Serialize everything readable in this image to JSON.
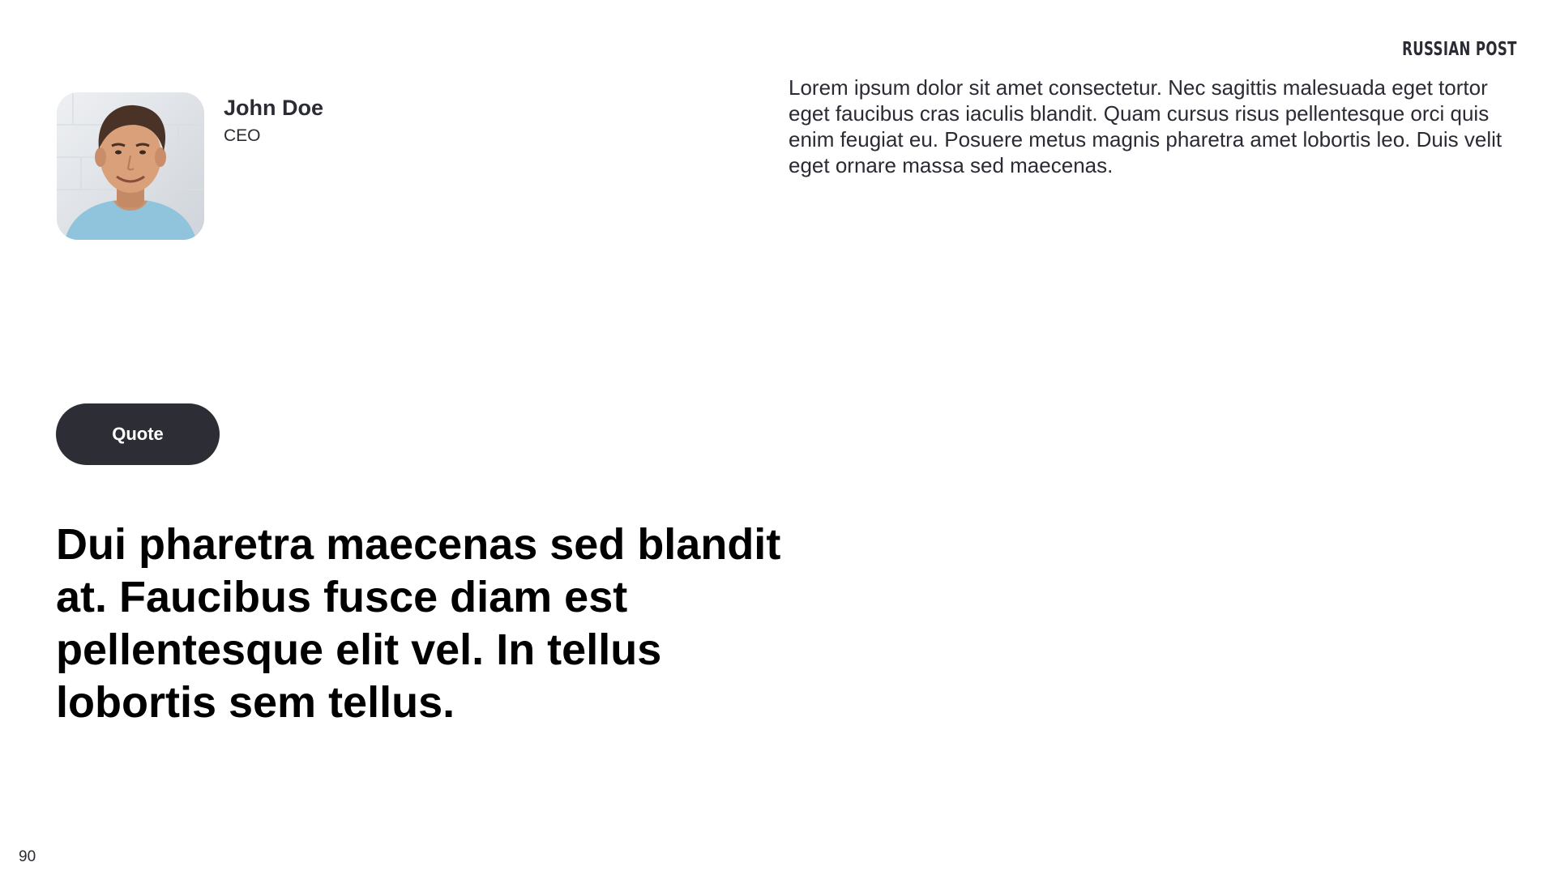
{
  "brand": {
    "logo_text": "RUSSIAN POST"
  },
  "profile": {
    "name": "John Doe",
    "role": "CEO"
  },
  "intro": {
    "text": "Lorem ipsum dolor sit amet consectetur. Nec sagittis malesuada eget tortor eget faucibus cras iaculis blandit. Quam cursus risus pellentesque orci quis enim feugiat eu. Posuere metus magnis pharetra amet lobortis leo. Duis velit eget ornare massa sed maecenas."
  },
  "quote": {
    "button_label": "Quote",
    "text": "Dui pharetra maecenas sed blandit at. Faucibus fusce diam est pellentesque elit vel. In tellus lobortis sem tellus."
  },
  "page": {
    "number": "90"
  },
  "colors": {
    "button_bg": "#2c2d35",
    "text_dark": "#2a2b33",
    "quote_text": "#000000"
  }
}
